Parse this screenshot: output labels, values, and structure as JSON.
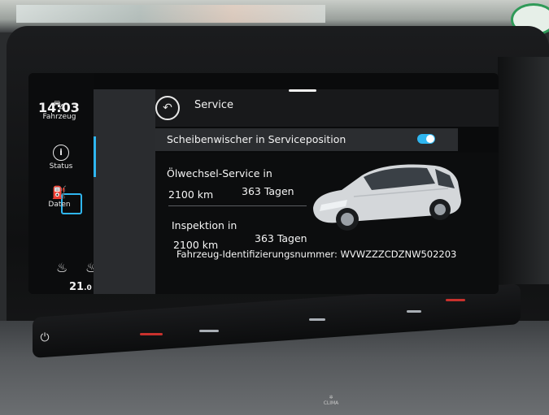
{
  "screen": {
    "clock": "14:03",
    "climate": {
      "temperature": "21",
      "temperature_decimal": ".0"
    },
    "nav": {
      "items": [
        {
          "label": "Fahrzeug",
          "icon": "car-icon"
        },
        {
          "label": "Status",
          "icon": "info-icon",
          "active": true
        },
        {
          "label": "Daten",
          "icon": "data-icon"
        }
      ]
    },
    "header": {
      "title": "Service",
      "back": "back-icon"
    },
    "wiper": {
      "label": "Scheibenwischer in Serviceposition",
      "enabled": true
    },
    "oil_service": {
      "label": "Ölwechsel-Service in",
      "distance": "2100 km",
      "days": "363 Tagen"
    },
    "inspection": {
      "label": "Inspektion in",
      "distance": "2100 km",
      "days": "363 Tagen"
    },
    "vin": "Fahrzeug-Identifizierungsnummer: WVWZZZCDZNW502203"
  },
  "console": {
    "climate_label": "CLIMA"
  },
  "colors": {
    "accent": "#2fb6f0",
    "panel": "#2a2c2f",
    "background": "#0a0b0c"
  }
}
